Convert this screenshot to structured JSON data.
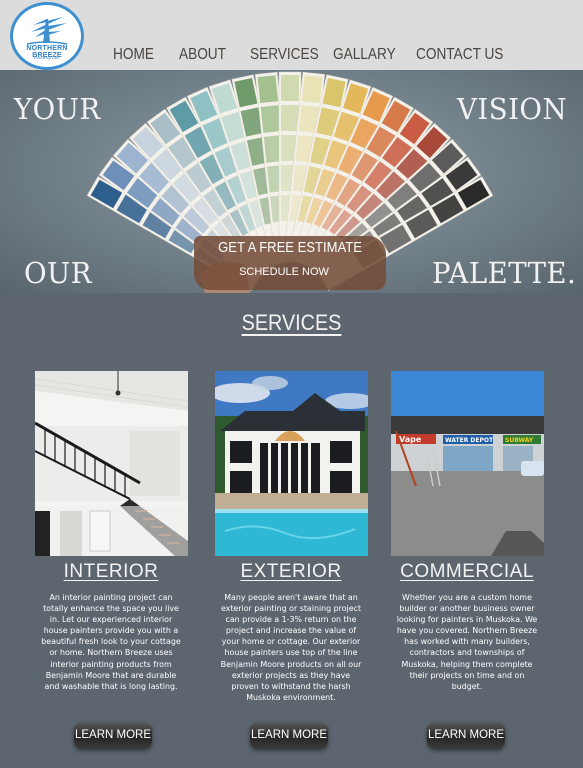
{
  "header": {
    "logo": {
      "name": "NORTHERN BREEZE",
      "tagline": "Painting Ltd."
    },
    "nav": [
      {
        "label": "HOME"
      },
      {
        "label": "ABOUT"
      },
      {
        "label": "SERVICES"
      },
      {
        "label": "GALLARY"
      },
      {
        "label": "CONTACT US"
      }
    ]
  },
  "hero": {
    "words": [
      "YOUR",
      "VISION",
      "OUR",
      "PALETTE."
    ],
    "cta_title": "GET A FREE ESTIMATE",
    "cta_subtitle": "SCHEDULE NOW"
  },
  "services": {
    "heading": "SERVICES",
    "cards": [
      {
        "title": "INTERIOR",
        "body": "An interior painting project can totally enhance the space you live in. Let our experienced interior house painters provide you with a beautiful fresh look to your cottage or home. Northern Breeze uses interior painting products from Benjamin Moore that are durable and washable that is long lasting.",
        "button": "LEARN MORE"
      },
      {
        "title": "EXTERIOR",
        "body": "Many people aren't aware that an exterior painting or staining project can provide a 1-3% return on the project and increase the value of your home or cottage. Our exterior house painters use top of the line Benjamin Moore products on all our exterior projects as they have proven to withstand the harsh Muskoka environment.",
        "button": "LEARN MORE"
      },
      {
        "title": "COMMERCIAL",
        "body": "Whether you are a custom home builder or another business owner looking for painters in Muskoka. We have you covered. Northern Breeze has worked with many builders, contractors and townships of Muskoka, helping them complete their projects on time and on budget.",
        "button": "LEARN MORE",
        "signs": [
          "Vape",
          "WATER DEPOT",
          "SUBWAY"
        ]
      }
    ]
  },
  "colors": {
    "page_bg": "#5d656e",
    "header_bg": "#dcdcdc",
    "logo_blue": "#2f7fc4",
    "cta_brown": "#744c38"
  }
}
